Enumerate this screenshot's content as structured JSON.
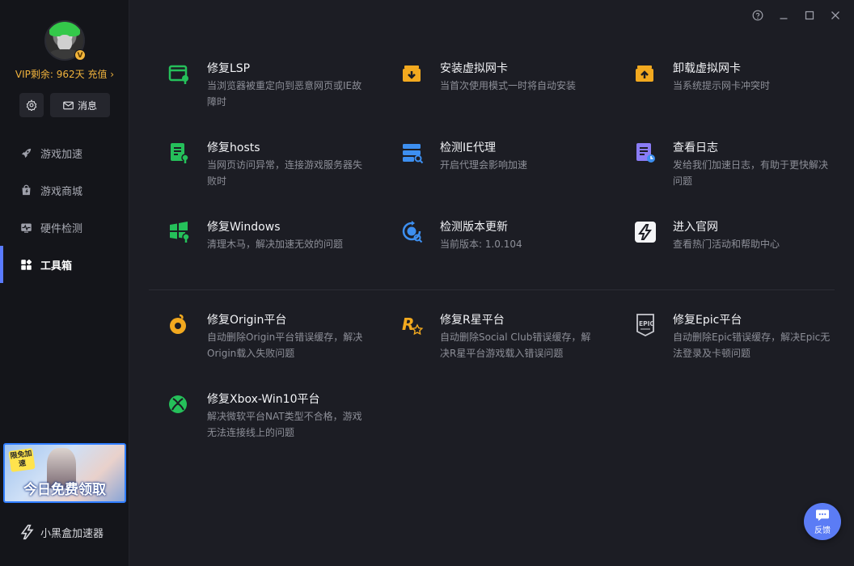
{
  "sidebar": {
    "vip_text": "VIP剩余: 962天 充值 ›",
    "vip_badge": "V",
    "message_label": "消息",
    "nav": [
      {
        "label": "游戏加速"
      },
      {
        "label": "游戏商城"
      },
      {
        "label": "硬件检测"
      },
      {
        "label": "工具箱"
      }
    ],
    "banner_tag": "限免加速",
    "banner_text": "今日免费领取",
    "brand_name": "小黑盒加速器"
  },
  "tools": [
    {
      "title": "修复LSP",
      "desc": "当浏览器被重定向到恶意网页或IE故障时"
    },
    {
      "title": "安装虚拟网卡",
      "desc": "当首次使用模式一时将自动安装"
    },
    {
      "title": "卸载虚拟网卡",
      "desc": "当系统提示网卡冲突时"
    },
    {
      "title": "修复hosts",
      "desc": "当网页访问异常，连接游戏服务器失败时"
    },
    {
      "title": "检测IE代理",
      "desc": "开启代理会影响加速"
    },
    {
      "title": "查看日志",
      "desc": "发给我们加速日志，有助于更快解决问题"
    },
    {
      "title": "修复Windows",
      "desc": "清理木马，解决加速无效的问题"
    },
    {
      "title": "检测版本更新",
      "desc": "当前版本: 1.0.104"
    },
    {
      "title": "进入官网",
      "desc": "查看热门活动和帮助中心"
    }
  ],
  "platforms": [
    {
      "title": "修复Origin平台",
      "desc": "自动删除Origin平台错误缓存，解决Origin载入失败问题"
    },
    {
      "title": "修复R星平台",
      "desc": "自动删除Social Club错误缓存，解决R星平台游戏载入错误问题"
    },
    {
      "title": "修复Epic平台",
      "desc": "自动删除Epic错误缓存，解决Epic无法登录及卡顿问题"
    },
    {
      "title": "修复Xbox-Win10平台",
      "desc": "解决微软平台NAT类型不合格，游戏无法连接线上的问题"
    }
  ],
  "feedback_label": "反馈",
  "colors": {
    "accent": "#5a7bff",
    "vip": "#f0b23c",
    "green_icon": "#25c05a",
    "orange_icon": "#f2a91f",
    "blue_icon": "#3d8ff0",
    "purple_icon": "#8a7cf5"
  },
  "icons": {
    "window": [
      "help-icon",
      "minimize-icon",
      "maximize-icon",
      "close-icon"
    ],
    "nav": [
      "rocket-icon",
      "store-icon",
      "hardware-icon",
      "toolbox-icon"
    ]
  }
}
